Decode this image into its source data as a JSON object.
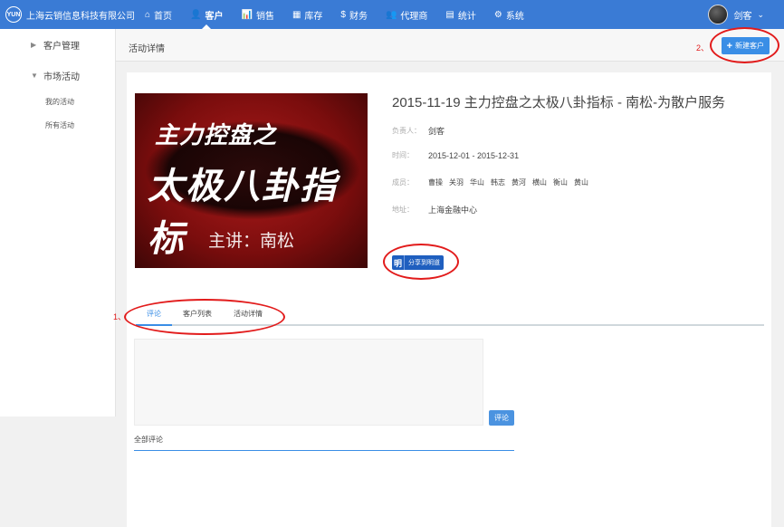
{
  "app": {
    "logo_text": "YUN",
    "company": "上海云销信息科技有限公司"
  },
  "nav": [
    {
      "icon": "home-icon",
      "glyph": "⌂",
      "label": "首页",
      "active": false
    },
    {
      "icon": "customer-icon",
      "glyph": "👤",
      "label": "客户",
      "active": true
    },
    {
      "icon": "sales-chart-icon",
      "glyph": "📊",
      "label": "销售",
      "active": false
    },
    {
      "icon": "warehouse-icon",
      "glyph": "▦",
      "label": "库存",
      "active": false
    },
    {
      "icon": "money-bag-icon",
      "glyph": "$",
      "label": "财务",
      "active": false
    },
    {
      "icon": "agents-icon",
      "glyph": "👥",
      "label": "代理商",
      "active": false
    },
    {
      "icon": "stats-icon",
      "glyph": "▤",
      "label": "统计",
      "active": false
    },
    {
      "icon": "gear-icon",
      "glyph": "⚙",
      "label": "系统",
      "active": false
    }
  ],
  "user": {
    "name": "剑客"
  },
  "sidebar": {
    "groups": [
      {
        "label": "客户管理",
        "expanded": false,
        "items": []
      },
      {
        "label": "市场活动",
        "expanded": true,
        "items": [
          {
            "label": "我的活动"
          },
          {
            "label": "所有活动"
          }
        ]
      }
    ]
  },
  "page": {
    "title": "活动详情",
    "new_button": "新建客户"
  },
  "event": {
    "banner": {
      "line1": "主力控盘之",
      "line2": "太极八卦指标",
      "line3": "主讲：南松"
    },
    "title": "2015-11-19 主力控盘之太极八卦指标 - 南松-为散户服务",
    "owner_label": "负责人：",
    "owner": "剑客",
    "time_label": "时间：",
    "time": "2015-12-01 - 2015-12-31",
    "members_label": "成员：",
    "members": [
      "曹操",
      "关羽",
      "华山",
      "韩志",
      "黄河",
      "横山",
      "衡山",
      "黄山"
    ],
    "address_label": "地址：",
    "address": "上海金融中心",
    "share": {
      "mark": "明",
      "label": "分享到明道"
    }
  },
  "tabs": [
    {
      "label": "评论",
      "active": true
    },
    {
      "label": "客户列表",
      "active": false
    },
    {
      "label": "活动详情",
      "active": false
    }
  ],
  "comment": {
    "placeholder": "",
    "submit_label": "评论",
    "all_label": "全部评论"
  },
  "annotations": {
    "one": "1、",
    "two": "2、"
  },
  "colors": {
    "topbar": "#3a7bd5",
    "accent": "#3a8ee6",
    "annotation": "#e21b1b"
  }
}
